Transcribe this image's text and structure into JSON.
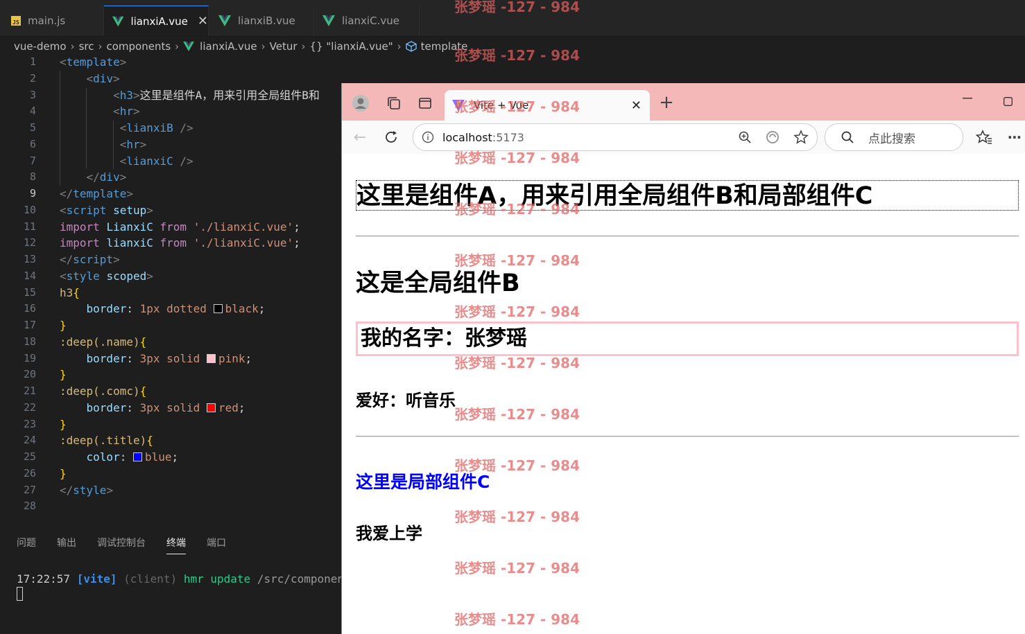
{
  "editor": {
    "tabs": [
      {
        "label": "main.js",
        "icon": "js-icon"
      },
      {
        "label": "lianxiA.vue",
        "icon": "vue-icon",
        "active": true
      },
      {
        "label": "lianxiB.vue",
        "icon": "vue-icon"
      },
      {
        "label": "lianxiC.vue",
        "icon": "vue-icon"
      }
    ],
    "breadcrumb": {
      "p0": "vue-demo",
      "p1": "src",
      "p2": "components",
      "p3": "lianxiA.vue",
      "p4": "Vetur",
      "p5": "{} \"lianxiA.vue\"",
      "p6": "template"
    },
    "line_numbers": [
      "1",
      "2",
      "3",
      "4",
      "5",
      "6",
      "7",
      "8",
      "9",
      "10",
      "11",
      "12",
      "13",
      "14",
      "15",
      "16",
      "17",
      "18",
      "19",
      "20",
      "21",
      "22",
      "23",
      "24",
      "25",
      "26",
      "27",
      "28"
    ],
    "current_line": "9",
    "code": {
      "l3_text": "这里是组件A，用来引用全局组件B和",
      "l11_import": "import",
      "l11_name": "LianxiC",
      "l11_from": "from",
      "l11_path": "'./lianxiC.vue'",
      "l12_import": "import",
      "l12_name": "lianxiC",
      "l12_from": "from",
      "l12_path": "'./lianxiC.vue'",
      "l16_prop": "border",
      "l16_val": "1px dotted",
      "l16_color": "black",
      "l19_prop": "border",
      "l19_val": "3px solid",
      "l19_color": "pink",
      "l22_prop": "border",
      "l22_val": "3px solid",
      "l22_color": "red",
      "l25_prop": "color",
      "l25_color": "blue",
      "swatch_colors": {
        "black": "#000000",
        "pink": "#ffc0cb",
        "red": "#ff0000",
        "blue": "#0000ff"
      }
    },
    "panel_tabs": [
      "问题",
      "输出",
      "调试控制台",
      "终端",
      "端口"
    ],
    "active_panel": "终端",
    "terminal": {
      "time": "17:22:57",
      "tag": "[vite]",
      "client": "(client)",
      "msg": "hmr update",
      "path": "/src/components/"
    }
  },
  "browser": {
    "tab_title": "Vite + Vue",
    "url_host": "localhost",
    "url_port": ":5173",
    "search_placeholder": "点此搜索",
    "titlebar_color": "#f4b8b8",
    "page": {
      "h3_a": "这里是组件A，用来引用全局组件B和局部组件C",
      "h2_b": "这是全局组件B",
      "name": "我的名字：张梦瑶",
      "hobby": "爱好：听音乐",
      "title_c": "这里是局部组件C",
      "study": "我爱上学"
    }
  },
  "watermark": "张梦瑶 -127 - 984"
}
